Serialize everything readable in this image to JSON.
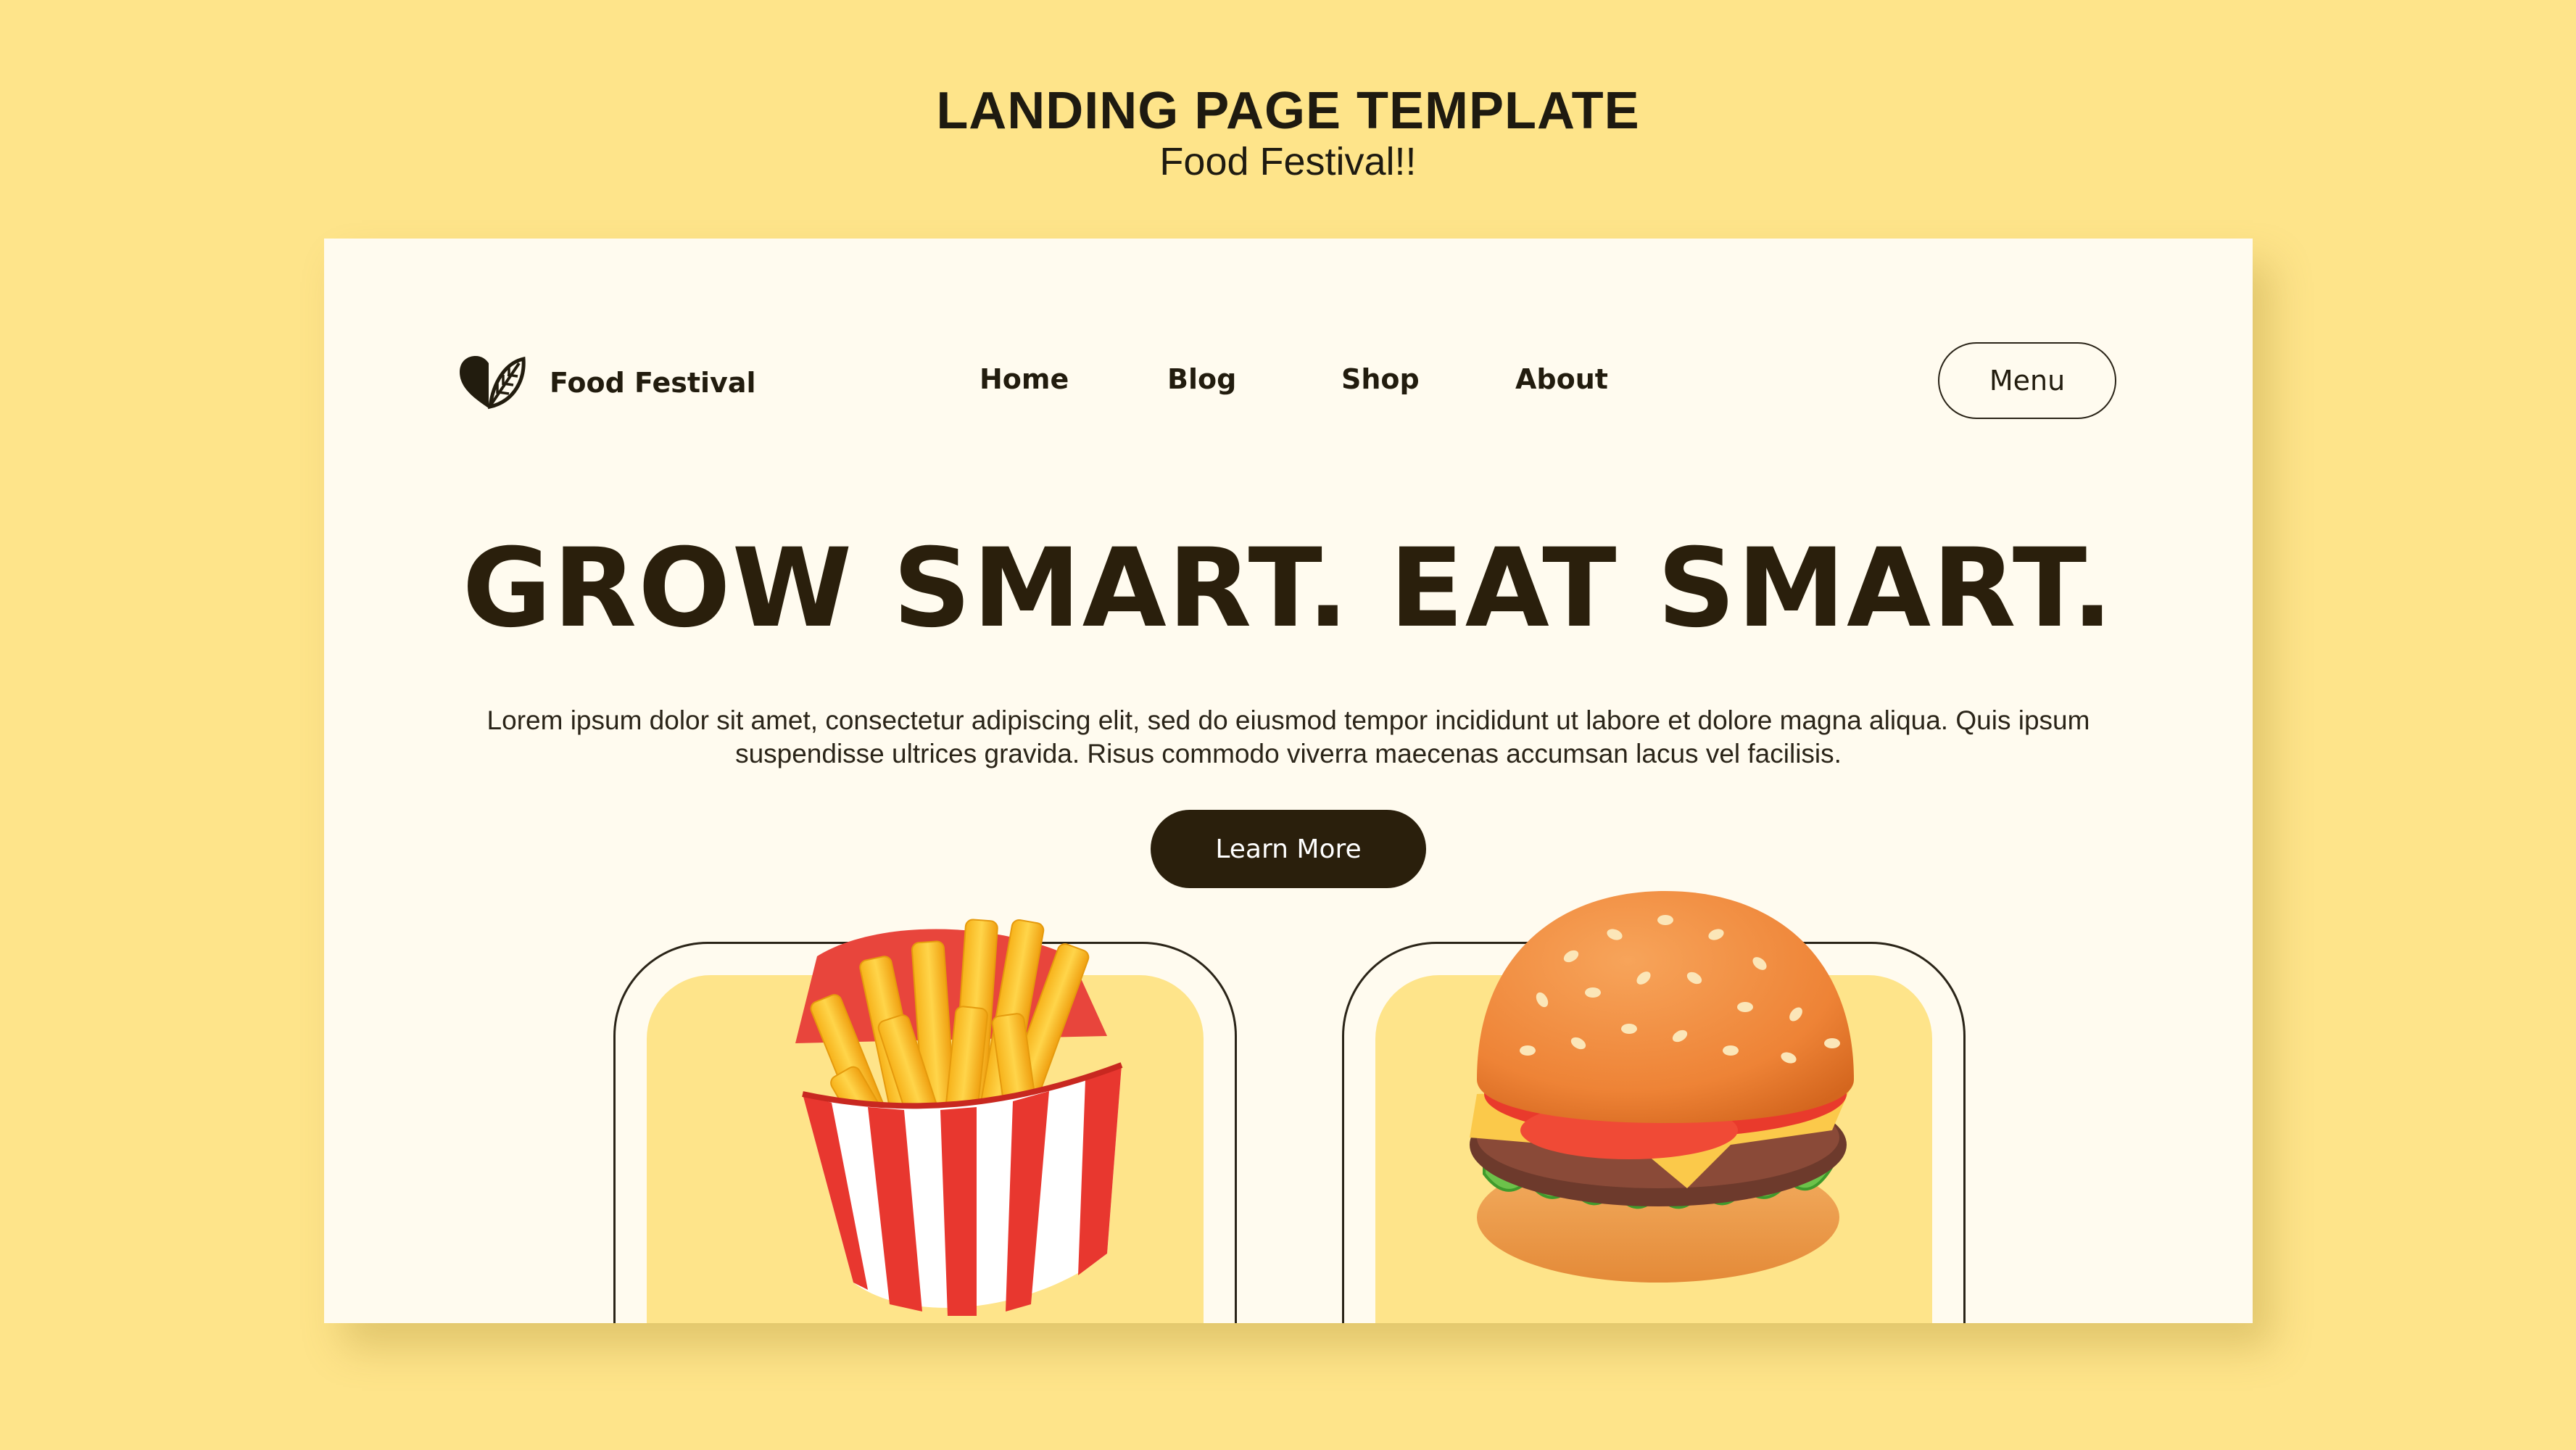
{
  "poster": {
    "title": "LANDING PAGE TEMPLATE",
    "subtitle": "Food Festival!!"
  },
  "header": {
    "logo_icon": "leaf-heart-icon",
    "brand": "Food Festival",
    "nav": [
      "Home",
      "Blog",
      "Shop",
      "About"
    ],
    "menu_label": "Menu"
  },
  "hero": {
    "headline": "GROW SMART. EAT SMART.",
    "body": "Lorem ipsum dolor sit amet, consectetur adipiscing elit, sed do eiusmod tempor incididunt ut labore et dolore magna aliqua. Quis ipsum suspendisse ultrices gravida. Risus commodo viverra maecenas accumsan lacus vel facilisis.",
    "cta_label": "Learn More"
  },
  "showcase": {
    "items": [
      "french-fries-illustration",
      "burger-illustration"
    ]
  },
  "colors": {
    "background": "#fee48a",
    "card": "#fffbef",
    "dark": "#2a1f0c",
    "accent_red": "#e83a36"
  }
}
